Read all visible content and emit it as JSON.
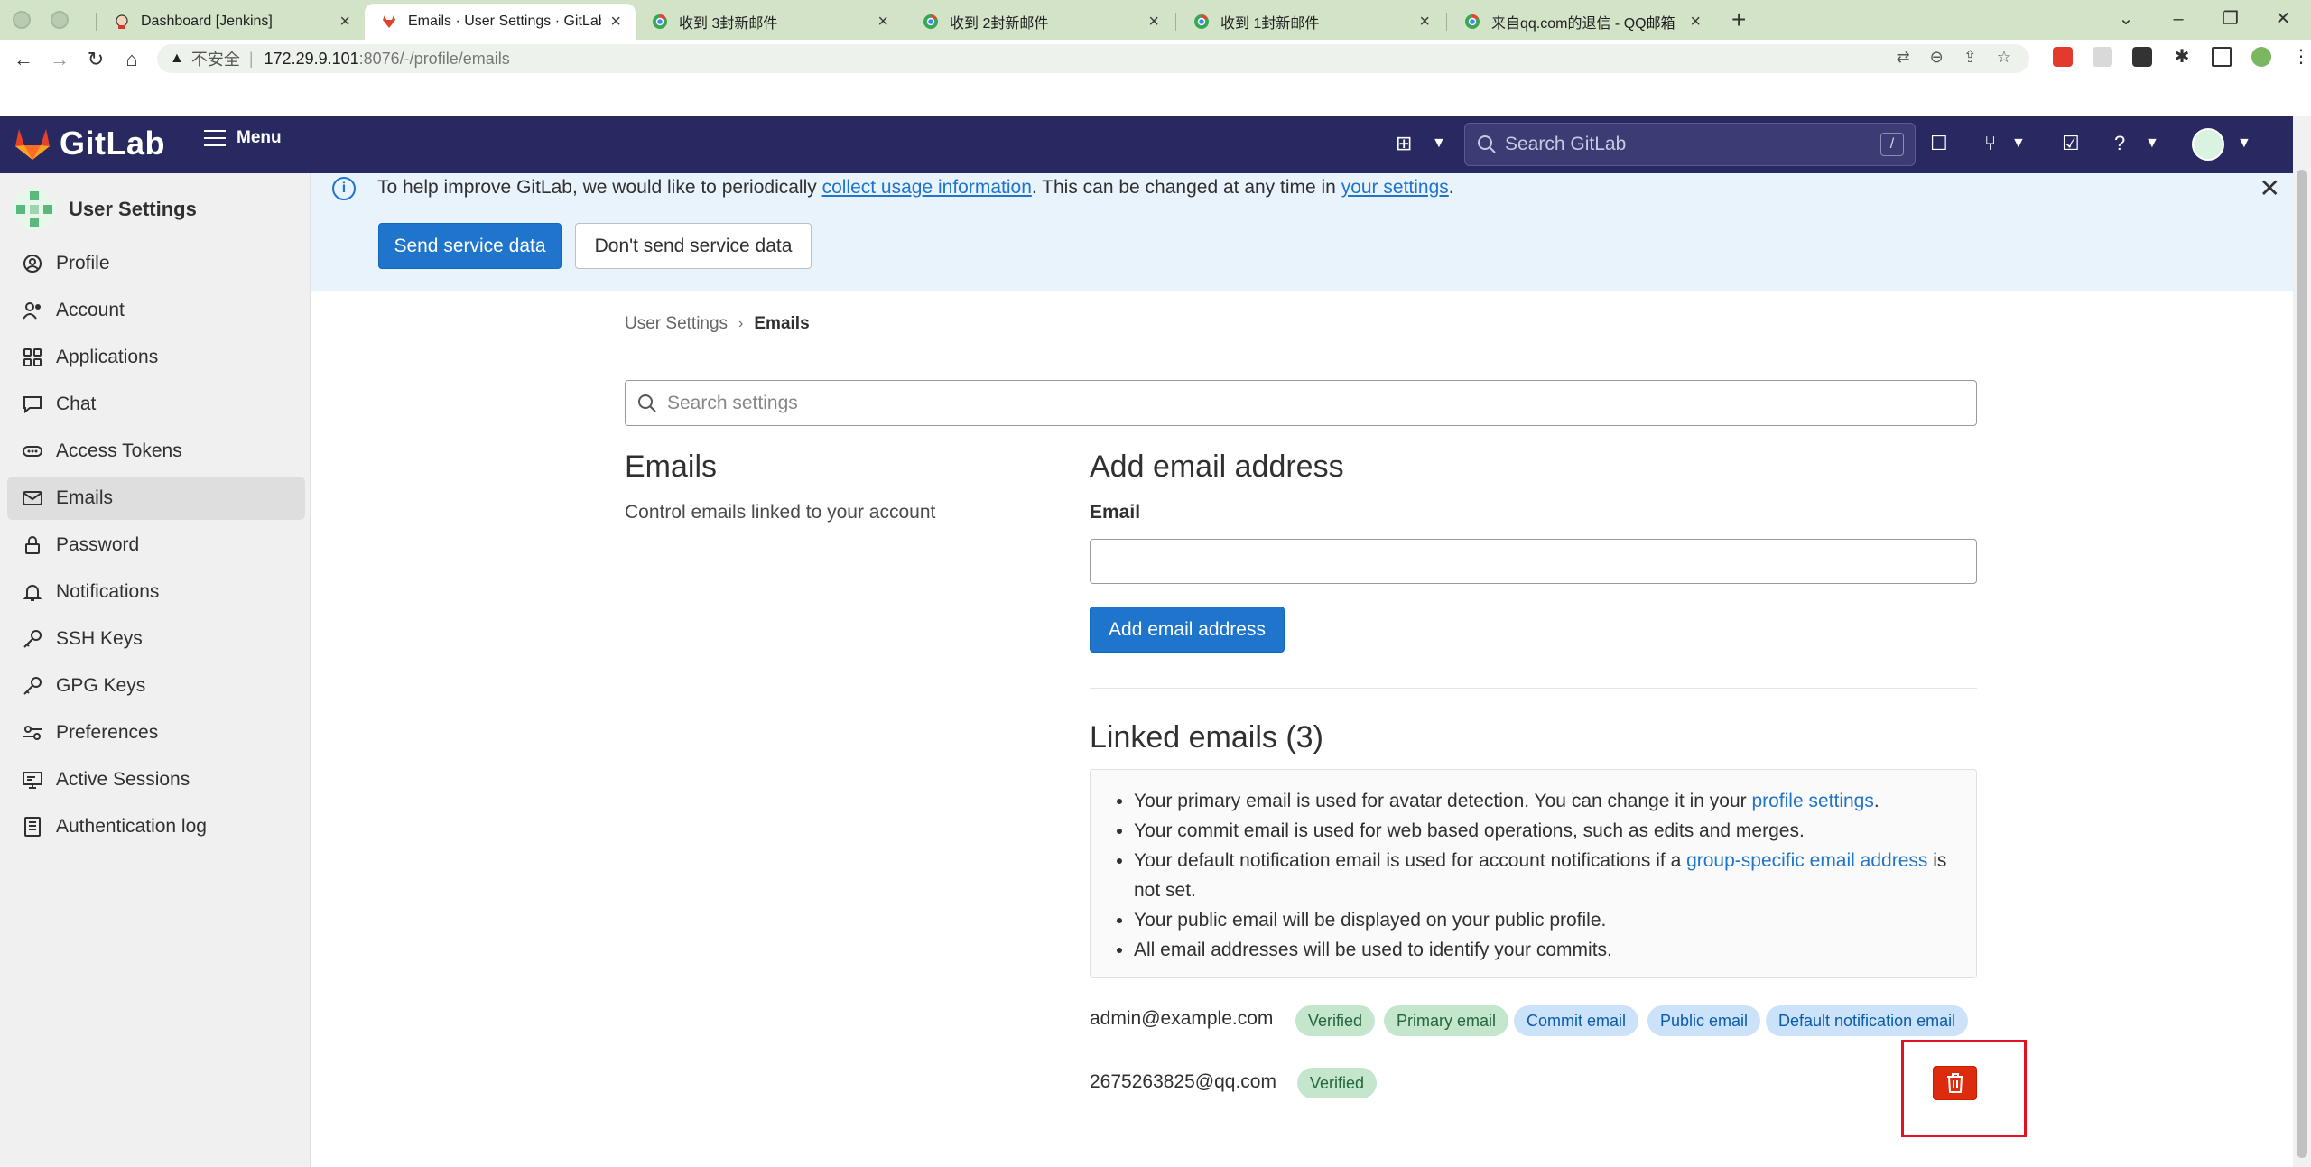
{
  "browser": {
    "tabs": [
      {
        "title": "Dashboard [Jenkins]",
        "active": false
      },
      {
        "title": "Emails · User Settings · GitLab",
        "active": true
      },
      {
        "title": "收到 3封新邮件",
        "active": false
      },
      {
        "title": "收到 2封新邮件",
        "active": false
      },
      {
        "title": "收到 1封新邮件",
        "active": false
      },
      {
        "title": "来自qq.com的退信 - QQ邮箱",
        "active": false
      }
    ],
    "address": {
      "insecure_label": "不安全",
      "host": "172.29.9.101",
      "path": ":8076/-/profile/emails"
    }
  },
  "header": {
    "brand": "GitLab",
    "menu_label": "Menu",
    "search_placeholder": "Search GitLab",
    "search_shortcut": "/"
  },
  "sidebar": {
    "title": "User Settings",
    "items": [
      {
        "label": "Profile",
        "icon": "user-circle-icon"
      },
      {
        "label": "Account",
        "icon": "account-icon"
      },
      {
        "label": "Applications",
        "icon": "applications-icon"
      },
      {
        "label": "Chat",
        "icon": "chat-icon"
      },
      {
        "label": "Access Tokens",
        "icon": "token-icon"
      },
      {
        "label": "Emails",
        "icon": "mail-icon",
        "active": true
      },
      {
        "label": "Password",
        "icon": "lock-icon"
      },
      {
        "label": "Notifications",
        "icon": "bell-icon"
      },
      {
        "label": "SSH Keys",
        "icon": "key-icon"
      },
      {
        "label": "GPG Keys",
        "icon": "key-icon"
      },
      {
        "label": "Preferences",
        "icon": "preferences-icon"
      },
      {
        "label": "Active Sessions",
        "icon": "monitor-icon"
      },
      {
        "label": "Authentication log",
        "icon": "log-icon"
      }
    ]
  },
  "banner": {
    "text_before": "To help improve GitLab, we would like to periodically ",
    "link1": "collect usage information",
    "text_middle": ". This can be changed at any time in ",
    "link2": "your settings",
    "text_after": ".",
    "send_label": "Send service data",
    "dont_send_label": "Don't send service data"
  },
  "breadcrumb": {
    "parent": "User Settings",
    "current": "Emails"
  },
  "settings_search_placeholder": "Search settings",
  "emails_section": {
    "title": "Emails",
    "description": "Control emails linked to your account"
  },
  "add_email": {
    "title": "Add email address",
    "field_label": "Email",
    "value": "",
    "button_label": "Add email address"
  },
  "linked": {
    "title": "Linked emails (3)",
    "info": {
      "line1_text": "Your primary email is used for avatar detection. You can change it in your ",
      "line1_link": "profile settings",
      "line1_end": ".",
      "line2": "Your commit email is used for web based operations, such as edits and merges.",
      "line3_text": "Your default notification email is used for account notifications if a ",
      "line3_link": "group-specific email address",
      "line3_end": " is not set.",
      "line4": "Your public email will be displayed on your public profile.",
      "line5": "All email addresses will be used to identify your commits."
    },
    "emails": [
      {
        "address": "admin@example.com",
        "badges": [
          "Verified",
          "Primary email",
          "Commit email",
          "Public email",
          "Default notification email"
        ]
      },
      {
        "address": "2675263825@qq.com",
        "badges": [
          "Verified"
        ]
      }
    ]
  },
  "colors": {
    "header_bg": "#292961",
    "primary_blue": "#1f75cb",
    "danger_red": "#dd2b0e",
    "banner_bg": "#e9f3fc",
    "tabbar_bg": "#d2e3c8"
  }
}
